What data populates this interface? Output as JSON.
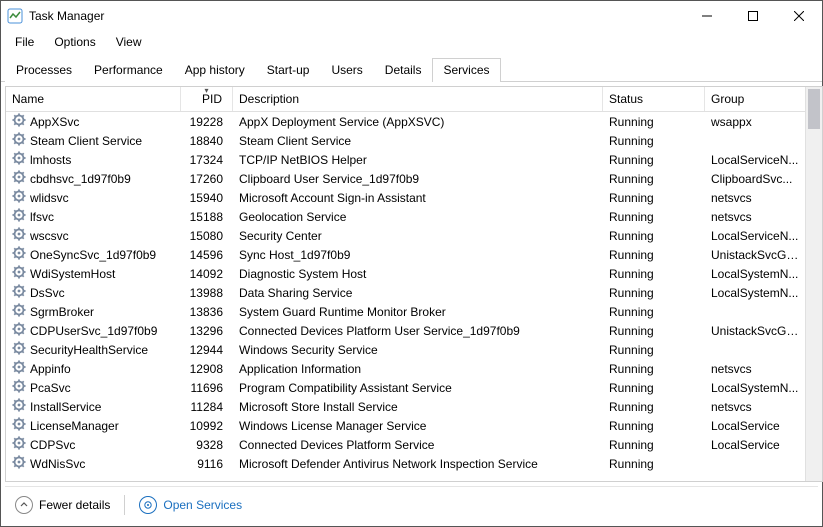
{
  "window": {
    "title": "Task Manager"
  },
  "menu": {
    "file": "File",
    "options": "Options",
    "view": "View"
  },
  "tabs": {
    "processes": "Processes",
    "performance": "Performance",
    "apphistory": "App history",
    "startup": "Start-up",
    "users": "Users",
    "details": "Details",
    "services": "Services"
  },
  "columns": {
    "name": "Name",
    "pid": "PID",
    "description": "Description",
    "status": "Status",
    "group": "Group"
  },
  "sort_indicator": "▾",
  "services": [
    {
      "name": "AppXSvc",
      "pid": "19228",
      "desc": "AppX Deployment Service (AppXSVC)",
      "status": "Running",
      "group": "wsappx"
    },
    {
      "name": "Steam Client Service",
      "pid": "18840",
      "desc": "Steam Client Service",
      "status": "Running",
      "group": ""
    },
    {
      "name": "lmhosts",
      "pid": "17324",
      "desc": "TCP/IP NetBIOS Helper",
      "status": "Running",
      "group": "LocalServiceN..."
    },
    {
      "name": "cbdhsvc_1d97f0b9",
      "pid": "17260",
      "desc": "Clipboard User Service_1d97f0b9",
      "status": "Running",
      "group": "ClipboardSvc..."
    },
    {
      "name": "wlidsvc",
      "pid": "15940",
      "desc": "Microsoft Account Sign-in Assistant",
      "status": "Running",
      "group": "netsvcs"
    },
    {
      "name": "lfsvc",
      "pid": "15188",
      "desc": "Geolocation Service",
      "status": "Running",
      "group": "netsvcs"
    },
    {
      "name": "wscsvc",
      "pid": "15080",
      "desc": "Security Center",
      "status": "Running",
      "group": "LocalServiceN..."
    },
    {
      "name": "OneSyncSvc_1d97f0b9",
      "pid": "14596",
      "desc": "Sync Host_1d97f0b9",
      "status": "Running",
      "group": "UnistackSvcGr..."
    },
    {
      "name": "WdiSystemHost",
      "pid": "14092",
      "desc": "Diagnostic System Host",
      "status": "Running",
      "group": "LocalSystemN..."
    },
    {
      "name": "DsSvc",
      "pid": "13988",
      "desc": "Data Sharing Service",
      "status": "Running",
      "group": "LocalSystemN..."
    },
    {
      "name": "SgrmBroker",
      "pid": "13836",
      "desc": "System Guard Runtime Monitor Broker",
      "status": "Running",
      "group": ""
    },
    {
      "name": "CDPUserSvc_1d97f0b9",
      "pid": "13296",
      "desc": "Connected Devices Platform User Service_1d97f0b9",
      "status": "Running",
      "group": "UnistackSvcGr..."
    },
    {
      "name": "SecurityHealthService",
      "pid": "12944",
      "desc": "Windows Security Service",
      "status": "Running",
      "group": ""
    },
    {
      "name": "Appinfo",
      "pid": "12908",
      "desc": "Application Information",
      "status": "Running",
      "group": "netsvcs"
    },
    {
      "name": "PcaSvc",
      "pid": "11696",
      "desc": "Program Compatibility Assistant Service",
      "status": "Running",
      "group": "LocalSystemN..."
    },
    {
      "name": "InstallService",
      "pid": "11284",
      "desc": "Microsoft Store Install Service",
      "status": "Running",
      "group": "netsvcs"
    },
    {
      "name": "LicenseManager",
      "pid": "10992",
      "desc": "Windows License Manager Service",
      "status": "Running",
      "group": "LocalService"
    },
    {
      "name": "CDPSvc",
      "pid": "9328",
      "desc": "Connected Devices Platform Service",
      "status": "Running",
      "group": "LocalService"
    },
    {
      "name": "WdNisSvc",
      "pid": "9116",
      "desc": "Microsoft Defender Antivirus Network Inspection Service",
      "status": "Running",
      "group": ""
    }
  ],
  "footer": {
    "fewer": "Fewer details",
    "open_services": "Open Services"
  }
}
